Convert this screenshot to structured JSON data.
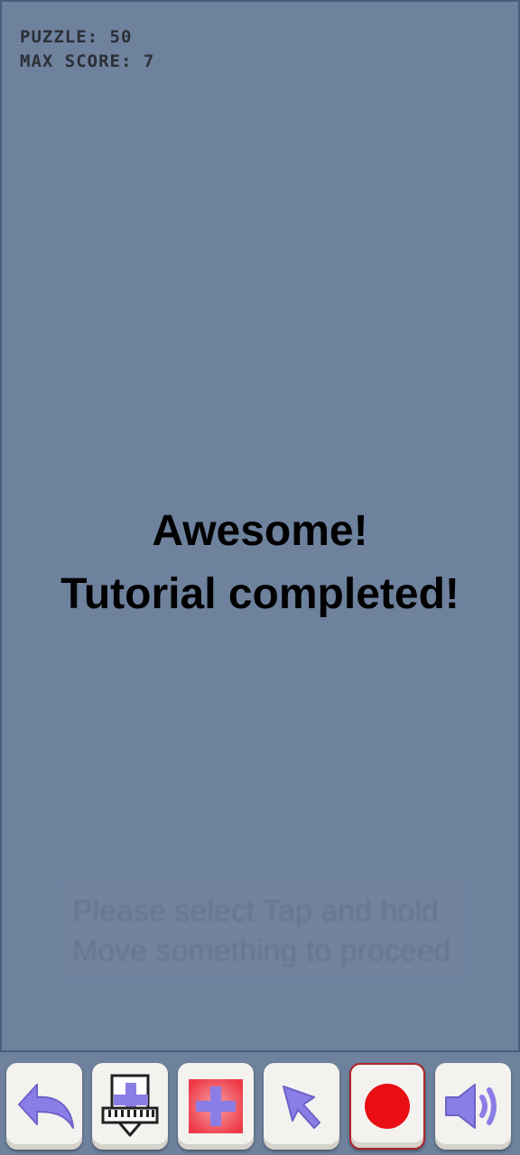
{
  "hud": {
    "puzzle": "PUZZLE: 50",
    "max_score": "MAX SCORE: 7"
  },
  "message": {
    "line1": "Awesome!",
    "line2": "Tutorial completed!"
  },
  "hint": {
    "line1": "Please select  Tap and hold",
    "line2": "Move something to proceed"
  },
  "toolbar": {
    "tools": [
      {
        "icon": "undo-arrow-icon"
      },
      {
        "icon": "keyboard-add-icon"
      },
      {
        "icon": "add-block-icon"
      },
      {
        "icon": "pointer-arrow-icon"
      },
      {
        "icon": "record-icon"
      },
      {
        "icon": "speaker-icon"
      }
    ]
  },
  "colors": {
    "background": "#6e829e",
    "accent": "#8a7ee6",
    "record": "#e80e14"
  }
}
